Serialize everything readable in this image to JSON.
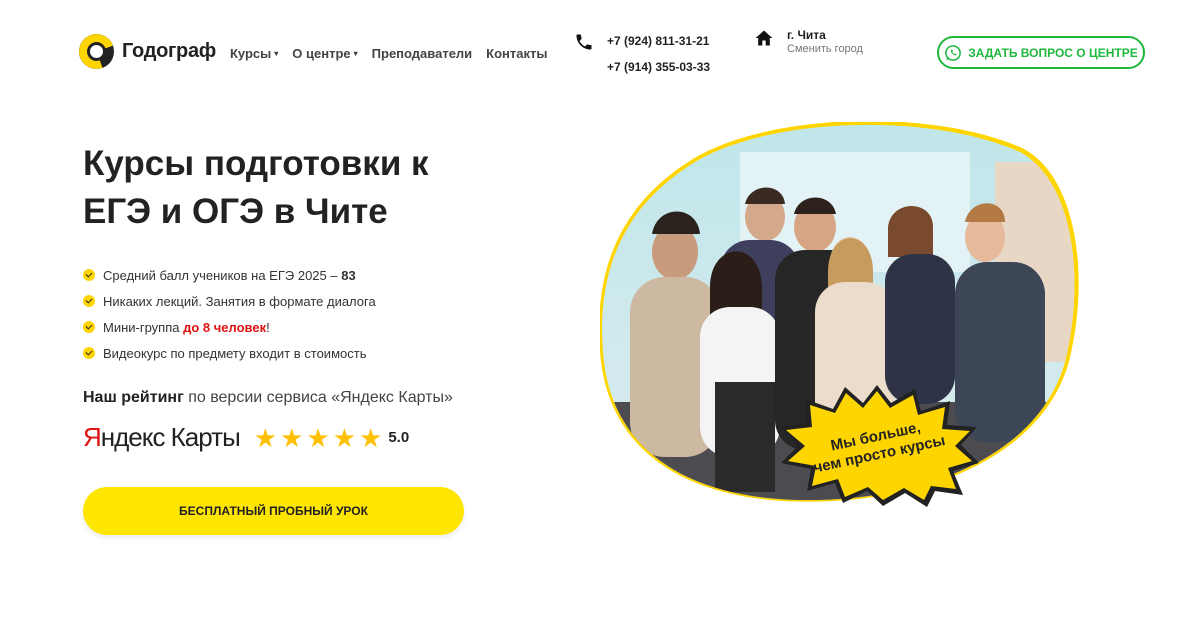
{
  "brand": {
    "name": "Годограф"
  },
  "nav": [
    {
      "label": "Курсы",
      "has_dropdown": true
    },
    {
      "label": "О центре",
      "has_dropdown": true
    },
    {
      "label": "Преподаватели",
      "has_dropdown": false
    },
    {
      "label": "Контакты",
      "has_dropdown": false
    }
  ],
  "contacts": {
    "phone_1": "+7 (924) 811-31-21",
    "phone_2": "+7 (914) 355-03-33"
  },
  "location": {
    "city": "г. Чита",
    "change_label": "Сменить город"
  },
  "ask_button": {
    "label": "ЗАДАТЬ ВОПРОС О ЦЕНТРЕ"
  },
  "hero": {
    "headline_line1": "Курсы подготовки к",
    "headline_line2": "ЕГЭ и ОГЭ в Чите",
    "features": [
      {
        "text": "Средний балл учеников на ЕГЭ 2025 – ",
        "highlight": "83"
      },
      {
        "text": "Никаких лекций. Занятия в формате диалога",
        "highlight": ""
      },
      {
        "text": "Мини-группа ",
        "highlight": "до 8 человек",
        "suffix": "!"
      },
      {
        "text": "Видеокурс по предмету входит в стоимость",
        "highlight": ""
      }
    ],
    "rating_caption_strong": "Наш рейтинг",
    "rating_caption_rest": " по версии сервиса «Яндекс Карты»",
    "rating_service_first": "Я",
    "rating_service_rest": "ндекс",
    "rating_service_second": " Карты",
    "rating_stars": 5,
    "rating_value": "5.0",
    "cta_label": "БЕСПЛАТНЫЙ ПРОБНЫЙ УРОК",
    "badge_line1": "Мы больше,",
    "badge_line2": "чем просто курсы"
  },
  "colors": {
    "accent_yellow": "#ffe600",
    "star": "#ffc107",
    "whatsapp_green": "#1eb83d",
    "highlight_red": "#e01313"
  }
}
